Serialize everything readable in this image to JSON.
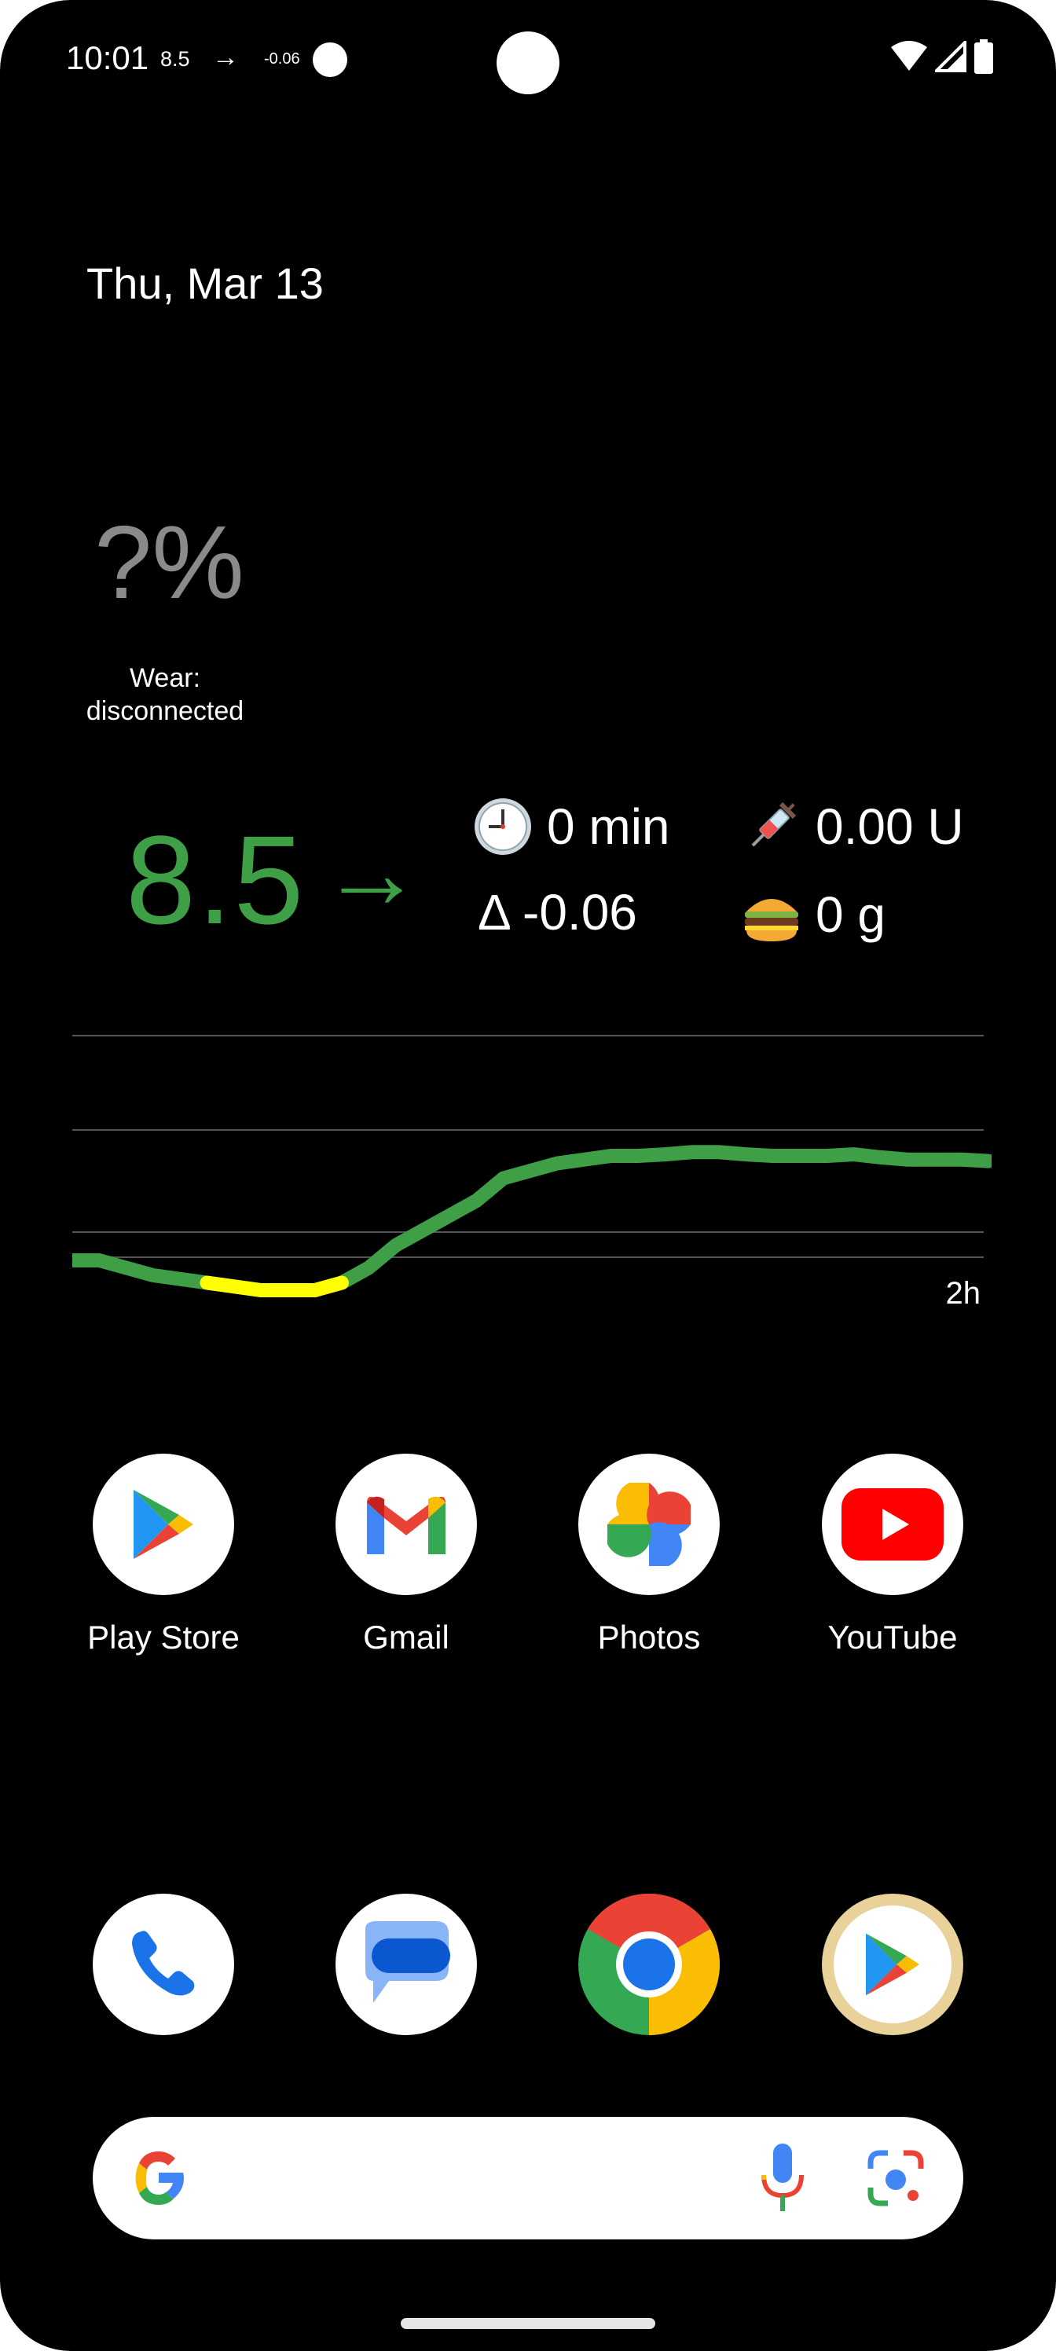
{
  "status_bar": {
    "time": "10:01",
    "bg": "8.5",
    "arrow": "→",
    "delta": "-0.06",
    "icons": [
      "wifi-icon",
      "signal-icon",
      "battery-icon"
    ]
  },
  "date": "Thu, Mar 13",
  "wear": {
    "battery_percent": "?%",
    "label": "Wear:\ndisconnected"
  },
  "glucose": {
    "value": "8.5",
    "arrow": "→",
    "color": "#3f9f46",
    "time_ago": "0 min",
    "delta": "Δ -0.06",
    "insulin": "0.00 U",
    "carbs": "0 g"
  },
  "chart_data": {
    "type": "line",
    "xlabel": "2h",
    "series": [
      {
        "color": "#3f9f46",
        "values": [
          6.3,
          6.3,
          6.2,
          6.1,
          6.05,
          6.0,
          5.95,
          5.9,
          5.9,
          5.9,
          6.0,
          6.2,
          6.5,
          6.7,
          6.9,
          7.1,
          7.4,
          7.5,
          7.6,
          7.65,
          7.7,
          7.7,
          7.72,
          7.75,
          7.75,
          7.72,
          7.7,
          7.7,
          7.7,
          7.72,
          7.68,
          7.65,
          7.65,
          7.65,
          7.63
        ]
      }
    ],
    "highlight_low": {
      "color": "#ffff00",
      "from_index": 5,
      "to_index": 10
    },
    "gridlines": 4
  },
  "apps": [
    {
      "label": "Play Store",
      "icon": "play-store-icon"
    },
    {
      "label": "Gmail",
      "icon": "gmail-icon"
    },
    {
      "label": "Photos",
      "icon": "photos-icon"
    },
    {
      "label": "YouTube",
      "icon": "youtube-icon"
    }
  ],
  "dock": [
    "phone-icon",
    "messages-icon",
    "chrome-icon",
    "play-store-icon"
  ],
  "search": {
    "icons": [
      "google-g-icon",
      "mic-icon",
      "lens-icon"
    ]
  }
}
